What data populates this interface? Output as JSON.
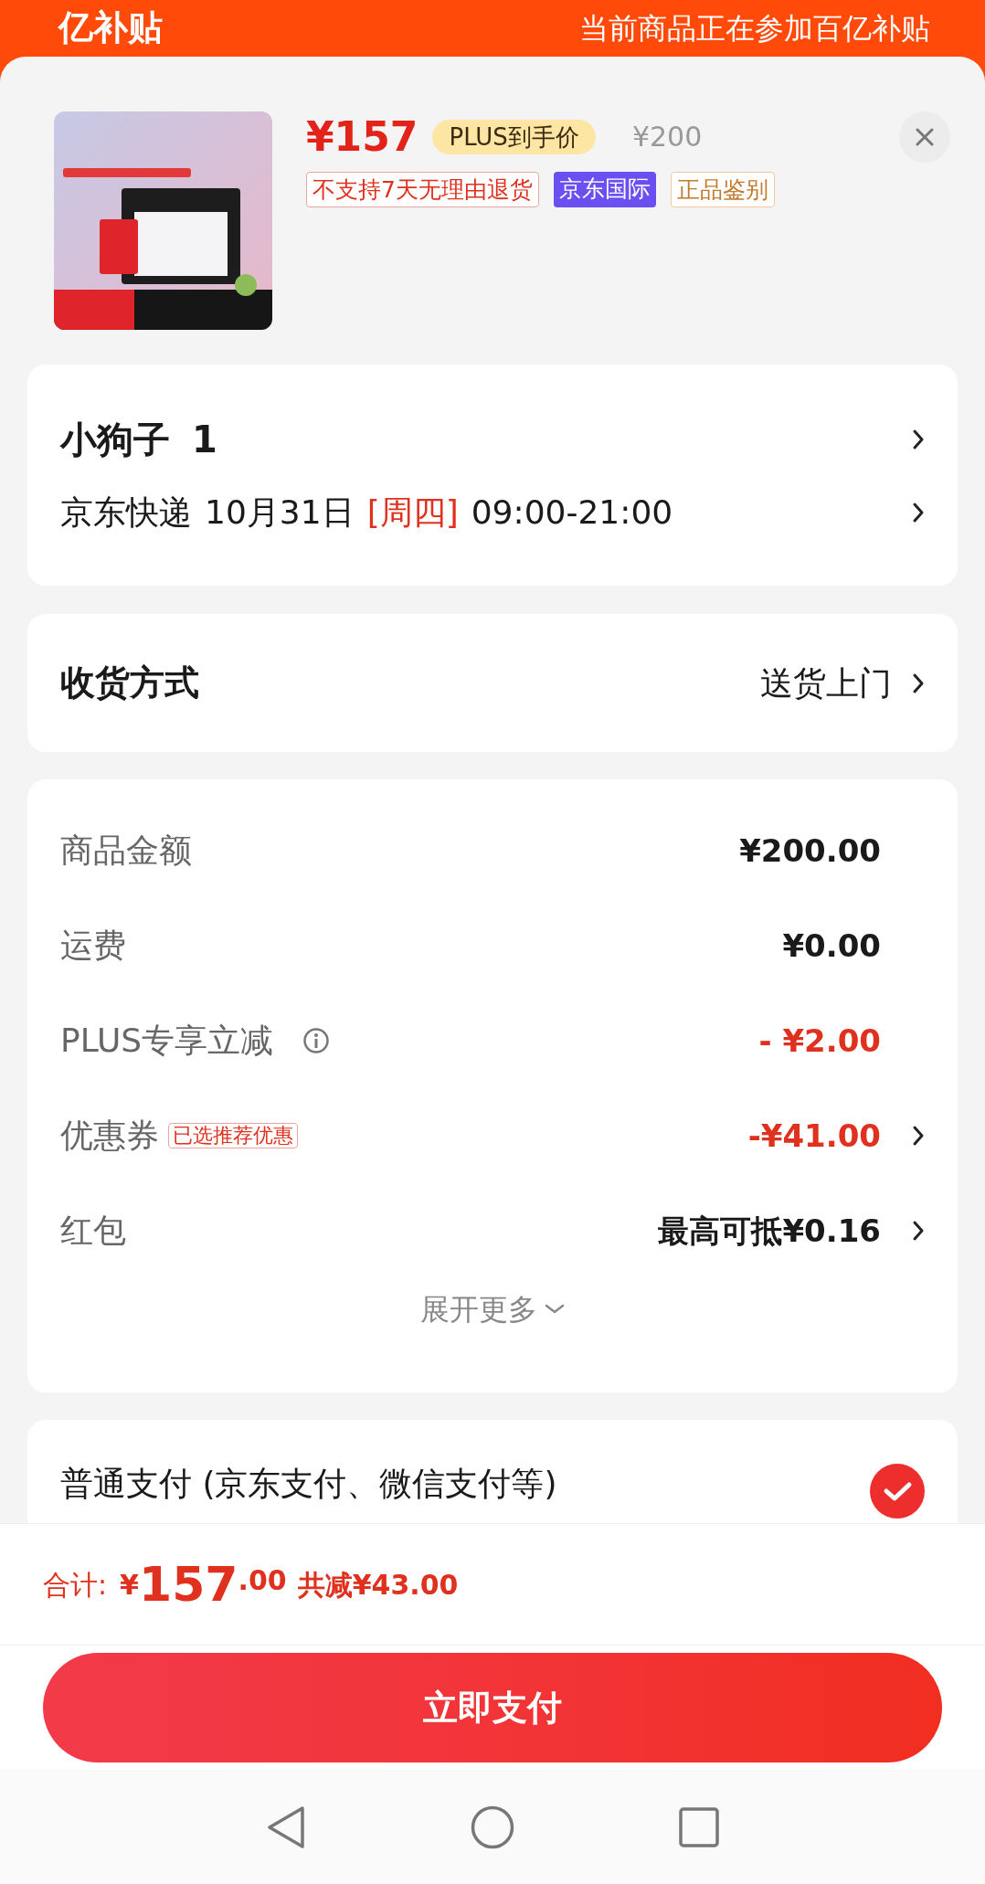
{
  "header": {
    "logo_text": "亿补贴",
    "notice": "当前商品正在参加百亿补贴"
  },
  "product": {
    "price": "¥157",
    "badge": "PLUS到手价",
    "original_price": "¥200",
    "tags": [
      {
        "kind": "outline-red",
        "label": "不支持7天无理由退货"
      },
      {
        "kind": "filled-purple",
        "label": "京东国际"
      },
      {
        "kind": "outline-gold",
        "label": "正品鉴别"
      }
    ]
  },
  "address": {
    "name": "小狗子",
    "number": "1",
    "carrier": "京东快递",
    "date": "10月31日",
    "weekday": "[周四]",
    "time": "09:00-21:00"
  },
  "shipping": {
    "label": "收货方式",
    "value": "送货上门"
  },
  "fees": [
    {
      "label": "商品金额",
      "value": "¥200.00",
      "kind": "charge",
      "info": false,
      "chevron": false
    },
    {
      "label": "运费",
      "value": "¥0.00",
      "kind": "charge",
      "info": false,
      "chevron": false
    },
    {
      "label": "PLUS专享立减",
      "value": "- ¥2.00",
      "kind": "discount",
      "info": true,
      "chevron": false
    },
    {
      "label": "优惠券",
      "tag": "已选推荐优惠",
      "value": "-¥41.00",
      "kind": "discount",
      "info": false,
      "chevron": true
    },
    {
      "label": "红包",
      "value": "最高可抵¥0.16",
      "kind": "charge",
      "info": false,
      "chevron": true
    }
  ],
  "expand": "展开更多",
  "payment": {
    "label": "普通支付 (京东支付、微信支付等)",
    "selected": true
  },
  "total": {
    "label": "合计:",
    "currency": "¥",
    "integer": "157",
    "decimal": ".00",
    "saved": "共减¥43.00"
  },
  "pay_button": "立即支付"
}
